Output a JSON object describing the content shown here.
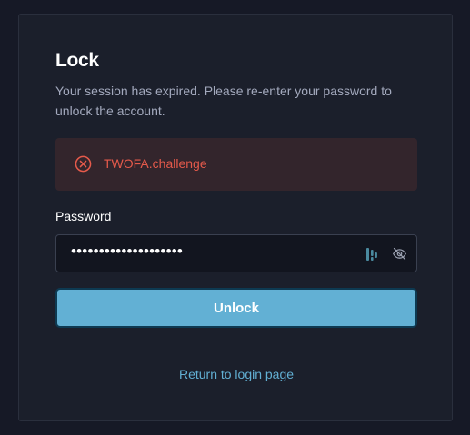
{
  "lock_card": {
    "title": "Lock",
    "subtitle": "Your session has expired. Please re-enter your password to unlock the account.",
    "alert": {
      "icon": "error-circle-x-icon",
      "message": "TWOFA.challenge",
      "color": "#e65a4b"
    },
    "password": {
      "label": "Password",
      "masked_value": "••••••••••••••••••••",
      "icons": [
        "password-manager-icon",
        "eye-off-icon"
      ]
    },
    "unlock_button": {
      "label": "Unlock",
      "color": "#62b0d4"
    },
    "return_link": {
      "label": "Return to login page",
      "color": "#62b0d4"
    }
  }
}
